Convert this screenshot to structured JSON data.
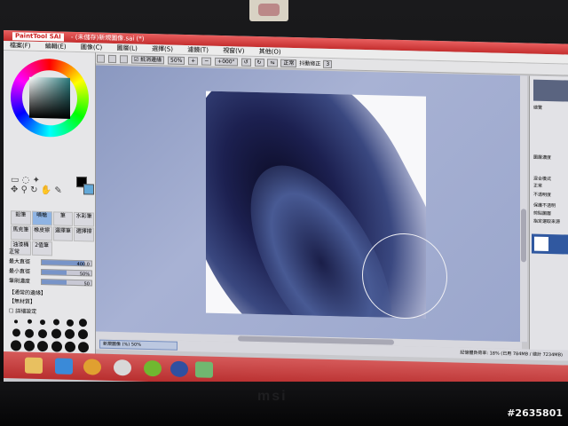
{
  "app": {
    "logo_text": "PaintTool SAI",
    "window_title": "- (未儲存)新規圖像.sai (*)"
  },
  "menu": {
    "items": [
      "檔案(F)",
      "編輯(E)",
      "圖像(C)",
      "圖層(L)",
      "選擇(S)",
      "濾鏡(T)",
      "視窗(V)",
      "其他(O)"
    ]
  },
  "toolbar": {
    "antialias_label": "抵消邊緣",
    "zoom_value": "50%",
    "angle_value": "+000°",
    "mode_value": "正常",
    "stabilizer_label": "抖動修正",
    "stabilizer_value": "3"
  },
  "tool_panel": {
    "brush_tools": [
      "鉛筆",
      "噴槍",
      "筆",
      "水彩筆",
      "馬克筆",
      "橡皮擦",
      "選擇筆",
      "選擇擦",
      "油漆桶",
      "2值筆"
    ],
    "selected_tool": "噴槍",
    "blend_mode": "正常",
    "max_size_label": "最大直徑",
    "max_size_value": "400.0",
    "max_size_fraction": 0.85,
    "min_size_label": "最小直徑",
    "min_size_value": "50%",
    "min_size_fraction": 0.5,
    "density_label": "筆刷濃度",
    "density_value": "50",
    "density_fraction": 0.5,
    "paper_texture": "【通常的邊緣】",
    "texture": "【無材質】",
    "detail_label": "詳細設定"
  },
  "right_panel": {
    "nav_label": "總覽",
    "rows": [
      "圖層濃度",
      "混合模式",
      "不透明度",
      "保護不透明",
      "剪貼圖層",
      "指定選取來源"
    ],
    "blend_value": "正常"
  },
  "status": {
    "doc_tab": "新規圖像 (%)",
    "doc_zoom": "50%",
    "memory": "記憶體負荷率: 18% (已用 784MB / 總計 7234MB)"
  },
  "watermark": "#2635801",
  "colors": {
    "primary": "#000000",
    "secondary": "#62a8d8",
    "accent": "#c42e2e"
  }
}
